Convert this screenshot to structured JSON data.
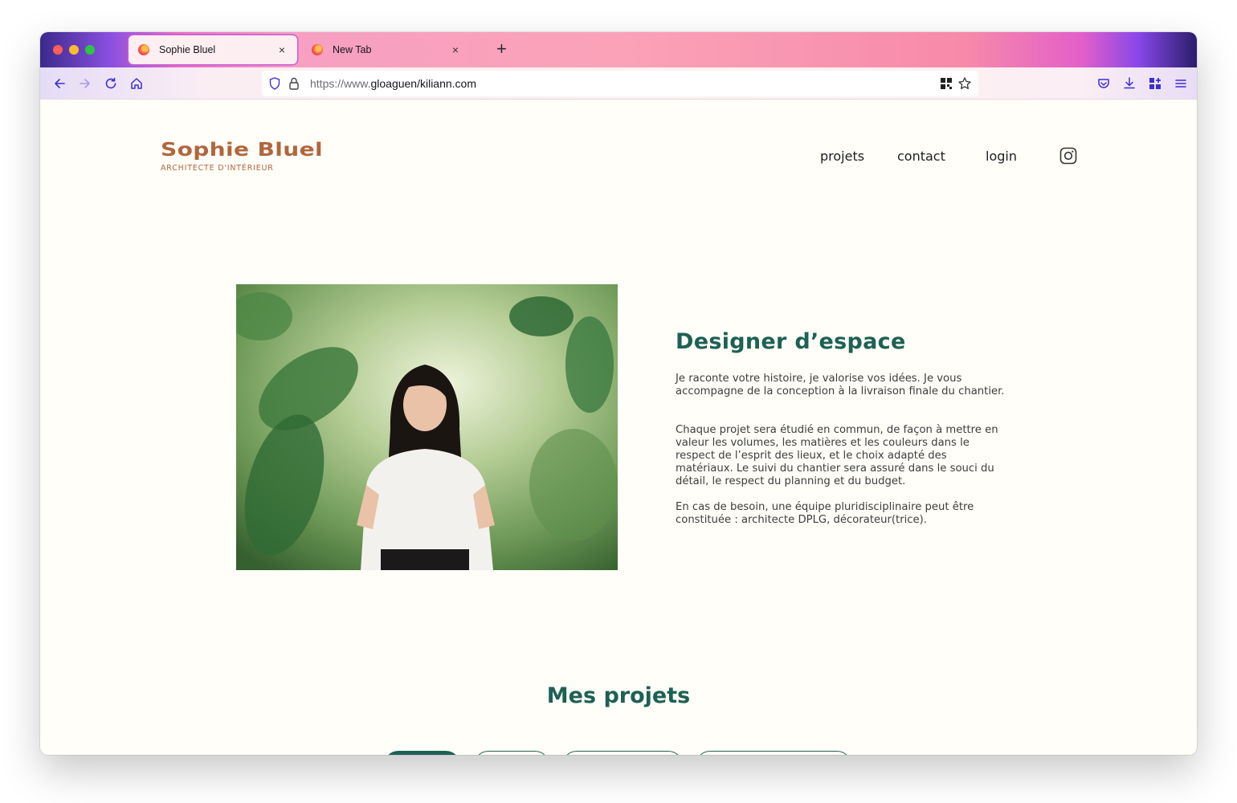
{
  "browser": {
    "tabs": [
      {
        "label": "Sophie Bluel",
        "active": true
      },
      {
        "label": "New Tab",
        "active": false
      }
    ],
    "new_tab_symbol": "+",
    "close_symbol": "×",
    "url": {
      "prefix": "https://www.",
      "domain": "gloaguen/kiliann.com"
    },
    "nav_icons": [
      "back-icon",
      "forward-icon",
      "reload-icon",
      "home-icon"
    ],
    "toolbar_icons": [
      "pocket-icon",
      "download-icon",
      "extensions-icon",
      "menu-icon"
    ]
  },
  "site": {
    "logo_title": "Sophie Bluel",
    "logo_subtitle": "ARCHITECTE D'INTÉRIEUR",
    "nav": [
      "projets",
      "contact",
      "login"
    ],
    "social_icon": "instagram-icon"
  },
  "hero": {
    "title": "Designer d’espace",
    "paragraphs": [
      "Je raconte votre histoire, je valorise vos idées. Je vous accompagne de la conception à la livraison finale du chantier.",
      "Chaque projet sera étudié en commun, de façon à mettre en valeur les volumes, les matières et les couleurs dans le respect de l’esprit des lieux, et le choix adapté des matériaux. Le suivi du chantier sera assuré dans le souci du détail, le respect du planning et du budget.",
      "En cas de besoin, une équipe pluridisciplinaire peut être constituée : architecte DPLG, décorateur(trice)."
    ]
  },
  "projects": {
    "title": "Mes projets"
  },
  "colors": {
    "accent_green": "#1d6154",
    "logo_brown": "#b1663c",
    "page_bg": "#fffef8"
  }
}
